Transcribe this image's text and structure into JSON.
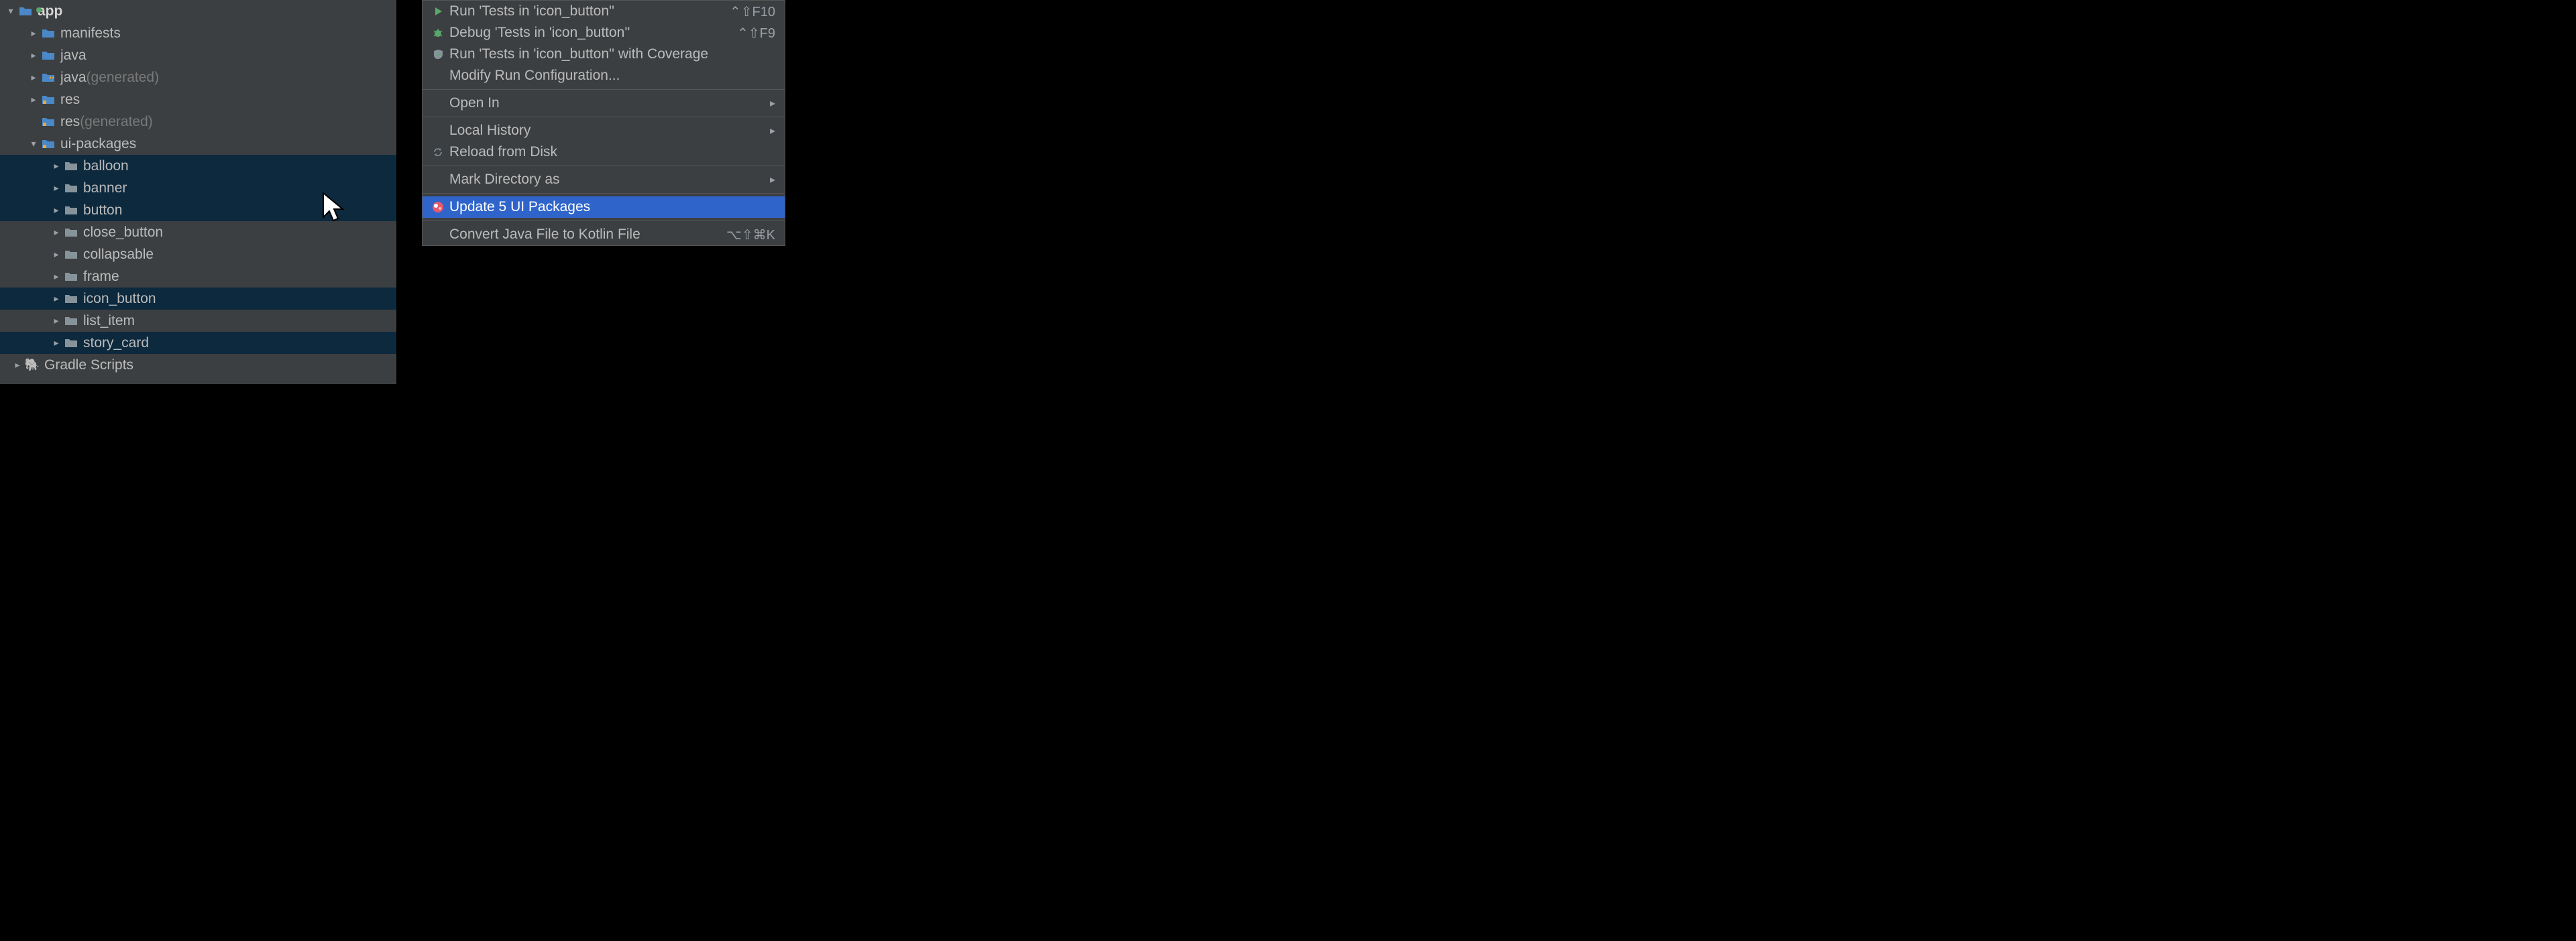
{
  "tree": {
    "app": {
      "label": "app",
      "expanded": true,
      "modified": true
    },
    "children1": [
      {
        "label": "manifests",
        "type": "folder",
        "hasChildren": true
      },
      {
        "label": "java",
        "type": "folder",
        "hasChildren": true
      },
      {
        "label": "java",
        "suffix": " (generated)",
        "type": "folder-gen",
        "hasChildren": true
      },
      {
        "label": "res",
        "type": "res",
        "hasChildren": true
      },
      {
        "label": "res",
        "suffix": " (generated)",
        "type": "res",
        "hasChildren": false
      },
      {
        "label": "ui-packages",
        "type": "res",
        "hasChildren": true,
        "expanded": true
      }
    ],
    "uiPackages": [
      {
        "label": "balloon",
        "selected": true
      },
      {
        "label": "banner",
        "selected": true
      },
      {
        "label": "button",
        "selected": true
      },
      {
        "label": "close_button",
        "selected": false
      },
      {
        "label": "collapsable",
        "selected": false
      },
      {
        "label": "frame",
        "selected": false
      },
      {
        "label": "icon_button",
        "selected": true
      },
      {
        "label": "list_item",
        "selected": false
      },
      {
        "label": "story_card",
        "selected": true
      }
    ],
    "gradle": {
      "label": "Gradle Scripts"
    }
  },
  "menu": {
    "run": {
      "label": "Run 'Tests in 'icon_button''",
      "shortcut": "⌃⇧F10"
    },
    "debug": {
      "label": "Debug 'Tests in 'icon_button''",
      "shortcut": "⌃⇧F9"
    },
    "coverage": {
      "label": "Run 'Tests in 'icon_button'' with Coverage"
    },
    "modify": {
      "label": "Modify Run Configuration..."
    },
    "openIn": {
      "label": "Open In"
    },
    "localHistory": {
      "label": "Local History"
    },
    "reload": {
      "label": "Reload from Disk"
    },
    "markDir": {
      "label": "Mark Directory as"
    },
    "update": {
      "label": "Update 5 UI Packages"
    },
    "convert": {
      "label": "Convert Java File to Kotlin File",
      "shortcut": "⌥⇧⌘K"
    }
  }
}
